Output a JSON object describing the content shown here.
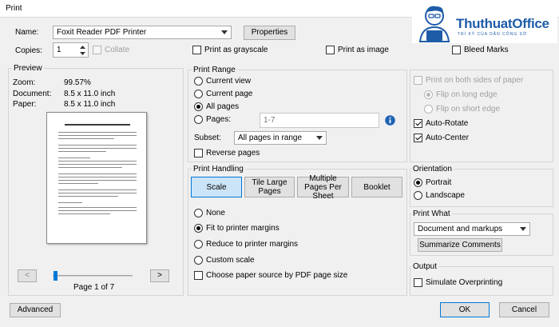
{
  "window": {
    "title": "Print"
  },
  "logo": {
    "name": "ThuthuatOffice",
    "tagline": "TRÍ KỲ CỦA DÂN CÔNG SỞ",
    "accent": "#1f5ca8"
  },
  "top": {
    "name_label": "Name:",
    "printer": "Foxit Reader PDF Printer",
    "properties": "Properties",
    "copies_label": "Copies:",
    "copies_value": "1",
    "collate": "Collate",
    "grayscale": "Print as grayscale",
    "as_image": "Print as image",
    "bleed_marks": "Bleed Marks"
  },
  "preview": {
    "title": "Preview",
    "zoom_label": "Zoom:",
    "zoom_value": "99.57%",
    "document_label": "Document:",
    "document_value": "8.5 x 11.0 inch",
    "paper_label": "Paper:",
    "paper_value": "8.5 x 11.0 inch",
    "prev": "<",
    "next": ">",
    "page_indicator": "Page 1 of 7",
    "slider_fraction": 0.0
  },
  "print_range": {
    "title": "Print Range",
    "current_view": "Current view",
    "current_page": "Current page",
    "all_pages": "All pages",
    "pages": "Pages:",
    "pages_value": "1-7",
    "subset_label": "Subset:",
    "subset_value": "All pages in range",
    "reverse_pages": "Reverse pages"
  },
  "print_handling": {
    "title": "Print Handling",
    "tabs": [
      "Scale",
      "Tile Large Pages",
      "Multiple Pages Per Sheet",
      "Booklet"
    ],
    "none": "None",
    "fit": "Fit to printer margins",
    "reduce": "Reduce to printer margins",
    "custom": "Custom scale",
    "paper_source": "Choose paper source by PDF page size"
  },
  "duplex": {
    "both_sides": "Print on both sides of paper",
    "long_edge": "Flip on long edge",
    "short_edge": "Flip on short edge",
    "auto_rotate": "Auto-Rotate",
    "auto_center": "Auto-Center"
  },
  "orientation": {
    "title": "Orientation",
    "portrait": "Portrait",
    "landscape": "Landscape"
  },
  "print_what": {
    "title": "Print What",
    "value": "Document and markups",
    "summarize": "Summarize Comments"
  },
  "output": {
    "title": "Output",
    "simulate": "Simulate Overprinting"
  },
  "footer": {
    "advanced": "Advanced",
    "ok": "OK",
    "cancel": "Cancel"
  }
}
